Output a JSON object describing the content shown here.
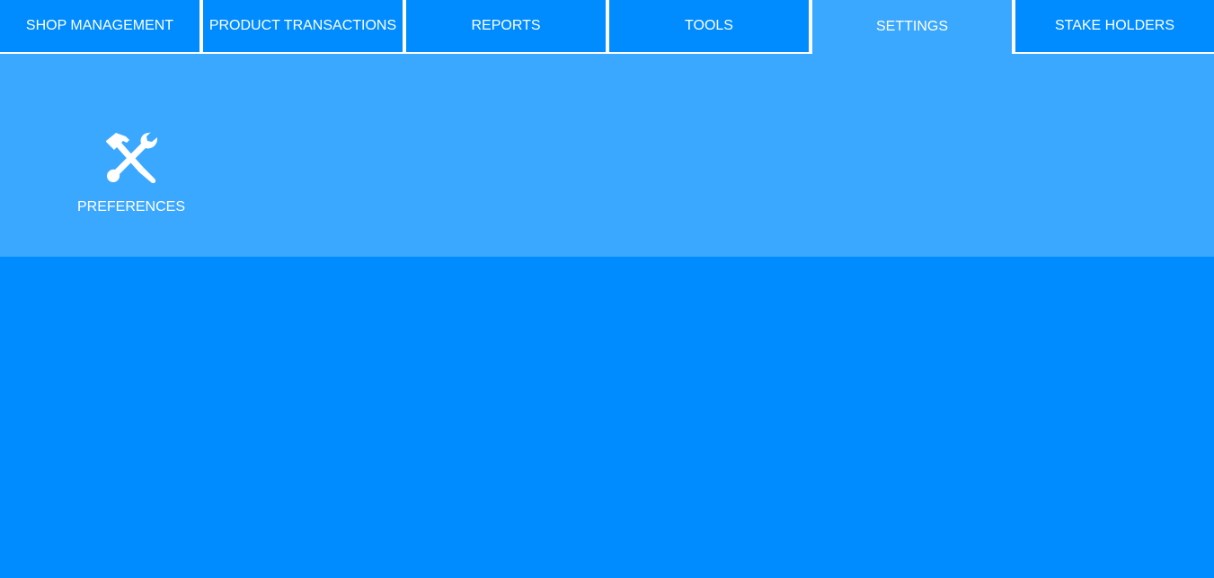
{
  "tabs": [
    {
      "label": "SHOP MANAGEMENT",
      "active": false
    },
    {
      "label": "PRODUCT TRANSACTIONS",
      "active": false
    },
    {
      "label": "REPORTS",
      "active": false
    },
    {
      "label": "TOOLS",
      "active": false
    },
    {
      "label": "SETTINGS",
      "active": true
    },
    {
      "label": "STAKE HOLDERS",
      "active": false
    }
  ],
  "settings_panel": {
    "items": [
      {
        "label": "PREFERENCES",
        "icon": "hammer-wrench-icon"
      }
    ]
  },
  "colors": {
    "tab_bg": "#008cff",
    "active_tab_bg": "#3ba8ff",
    "panel_bg": "#3ba8ff",
    "workspace_bg": "#008cff",
    "text": "#ffffff",
    "divider": "#ffffff"
  }
}
